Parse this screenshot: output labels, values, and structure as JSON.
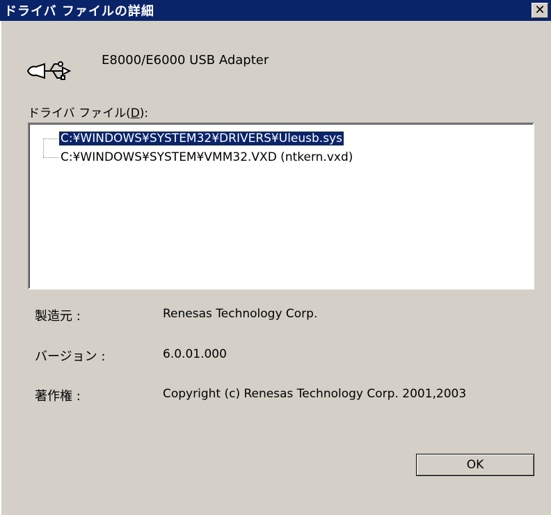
{
  "window": {
    "title": "ドライバ ファイルの詳細",
    "close_label": "✕"
  },
  "device": {
    "icon": "usb-icon",
    "name": "E8000/E6000 USB Adapter"
  },
  "driver_files": {
    "label_prefix": "ドライバ ファイル(",
    "label_accel": "D",
    "label_suffix": "):",
    "items": [
      {
        "path": "C:¥WINDOWS¥SYSTEM32¥DRIVERS¥Uleusb.sys",
        "selected": true
      },
      {
        "path": "C:¥WINDOWS¥SYSTEM¥VMM32.VXD (ntkern.vxd)",
        "selected": false
      }
    ]
  },
  "details": {
    "provider_label": "製造元 :",
    "provider_value": "Renesas Technology Corp.",
    "version_label": "バージョン :",
    "version_value": "6.0.01.000",
    "copyright_label": "著作権 :",
    "copyright_value": "Copyright (c) Renesas Technology Corp. 2001,2003"
  },
  "buttons": {
    "ok_label": "OK"
  },
  "colors": {
    "titlebar": "#0a246a",
    "dialog_bg": "#d4d0c8",
    "selection": "#0a246a"
  }
}
